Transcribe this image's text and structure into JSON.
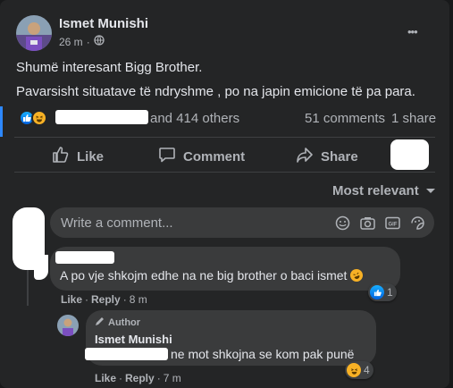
{
  "post": {
    "author": "Ismet Munishi",
    "time": "26 m",
    "dot": "·",
    "more": "•••",
    "line1": "Shumë interesant Bigg Brother.",
    "line2": "Pavarsisht situatave të ndryshme , po na japin emicione të pa para.",
    "reactions_others": "and 414 others",
    "comments_count": "51 comments",
    "shares_count": "1 share"
  },
  "actions": {
    "like": "Like",
    "comment": "Comment",
    "share": "Share"
  },
  "sort": {
    "label": "Most relevant"
  },
  "composer": {
    "placeholder": "Write a comment..."
  },
  "comments": [
    {
      "text": "A po vje shkojm edhe na ne big brother o baci ismet",
      "like": "Like",
      "reply": "Reply",
      "dot": "·",
      "time": "8 m",
      "reaction_count": "1"
    },
    {
      "badge": "Author",
      "author": "Ismet Munishi",
      "text": "ne mot shkojna se kom pak punë",
      "like": "Like",
      "reply": "Reply",
      "dot": "·",
      "time": "7 m",
      "reaction_count": "4"
    }
  ],
  "colors": {
    "background": "#242526",
    "bubble": "#3a3b3c",
    "text": "#e4e6eb",
    "muted": "#b0b3b8",
    "like_blue": "#2d88ff",
    "haha_yellow": "#f7b125"
  }
}
